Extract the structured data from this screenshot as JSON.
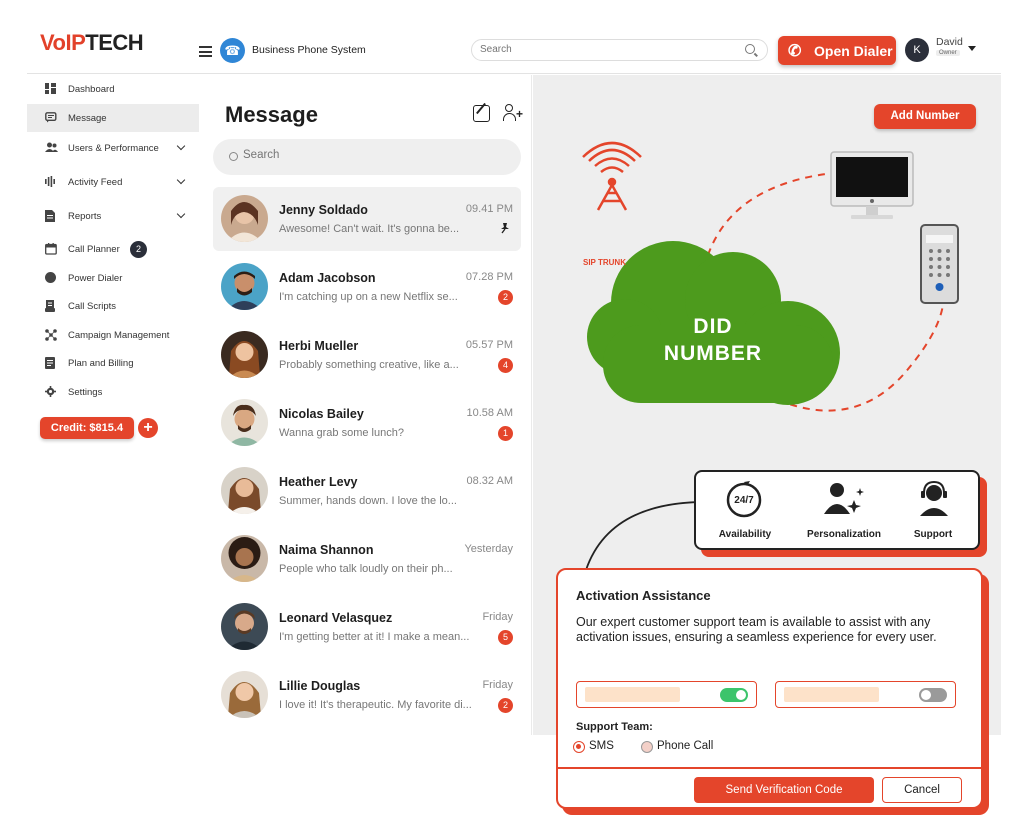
{
  "brand": {
    "logo_part1": "VoIP",
    "logo_part2": "TECH"
  },
  "header": {
    "app_title": "Business Phone System",
    "search_placeholder": "Search",
    "open_dialer_label": "Open Dialer",
    "user_initial": "K",
    "user_name": "David",
    "user_role": "Owner"
  },
  "sidebar": {
    "items": [
      {
        "label": "Dashboard"
      },
      {
        "label": "Message"
      },
      {
        "label": "Users & Performance"
      },
      {
        "label": "Activity Feed"
      },
      {
        "label": "Reports"
      },
      {
        "label": "Call Planner",
        "count": "2"
      },
      {
        "label": "Power Dialer"
      },
      {
        "label": "Call Scripts"
      },
      {
        "label": "Campaign Management"
      },
      {
        "label": "Plan and Billing"
      },
      {
        "label": "Settings"
      }
    ],
    "credit_label": "Credit: $815.4",
    "credit_plus": "+"
  },
  "messages": {
    "title": "Message",
    "search_placeholder": "Search",
    "conversations": [
      {
        "name": "Jenny Soldado",
        "preview": "Awesome! Can't wait. It's gonna be...",
        "time": "09.41 PM",
        "pinned": true
      },
      {
        "name": "Adam Jacobson",
        "preview": "I'm catching up on a new Netflix se...",
        "time": "07.28 PM",
        "unread": "2"
      },
      {
        "name": "Herbi Mueller",
        "preview": "Probably something creative, like a...",
        "time": "05.57 PM",
        "unread": "4"
      },
      {
        "name": "Nicolas Bailey",
        "preview": "Wanna grab some lunch?",
        "time": "10.58 AM",
        "unread": "1"
      },
      {
        "name": "Heather Levy",
        "preview": "Summer, hands down. I love the lo...",
        "time": "08.32 AM"
      },
      {
        "name": "Naima Shannon",
        "preview": "People who talk loudly on their ph...",
        "time": "Yesterday"
      },
      {
        "name": "Leonard Velasquez",
        "preview": "I'm getting better at it! I make a mean...",
        "time": "Friday",
        "unread": "5"
      },
      {
        "name": "Lillie Douglas",
        "preview": "I love it! It's therapeutic. My favorite di...",
        "time": "Friday",
        "unread": "2"
      }
    ]
  },
  "illustration": {
    "add_number_label": "Add Number",
    "sip_trunk_label": "SIP TRUNK",
    "did_line1": "DID",
    "did_line2": "NUMBER",
    "badge_text": "24/7",
    "services": [
      {
        "label": "Availability"
      },
      {
        "label": "Personalization"
      },
      {
        "label": "Support"
      }
    ]
  },
  "activation": {
    "title": "Activation Assistance",
    "description": "Our expert customer support team is available to assist with any activation issues, ensuring a seamless experience for every user.",
    "support_team_label": "Support Team:",
    "options": [
      {
        "label": "SMS",
        "selected": true
      },
      {
        "label": "Phone Call",
        "selected": false
      }
    ],
    "send_label": "Send Verification Code",
    "cancel_label": "Cancel",
    "toggle1_on": true,
    "toggle2_on": false
  },
  "colors": {
    "accent": "#e4452b",
    "green": "#4a9d1e",
    "toggle_on": "#3cc46b",
    "dark": "#2b2f3a"
  }
}
